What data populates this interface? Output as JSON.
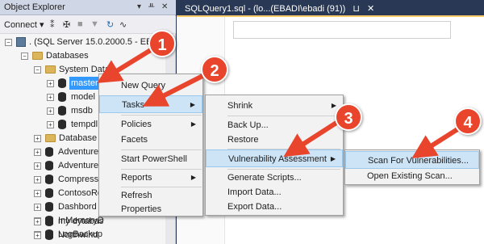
{
  "object_explorer": {
    "title": "Object Explorer",
    "pin_glyph": "▾ ⊔ ✕",
    "toolbar": {
      "connect_label": "Connect ▾"
    },
    "tree": {
      "server": ". (SQL Server 15.0.2000.5 - EBADI",
      "databases": "Databases",
      "system_databases": "System Datab",
      "system_dbs": [
        "master",
        "model",
        "msdb",
        "tempdl"
      ],
      "db_snapshots": "Database S",
      "user_dbs": [
        "AdventureW",
        "AdventureW",
        "Compressi",
        "ContosoRe",
        "Dashbord",
        "InMemoryD",
        "LogBackup",
        "my dytabas",
        "Northwind"
      ]
    }
  },
  "tab": {
    "label": "SQLQuery1.sql - (lo...(EBADI\\ebadi (91))",
    "pin": "⊔",
    "close": "✕"
  },
  "menu1": {
    "items": [
      "New Query",
      "Tasks",
      "Policies",
      "Facets",
      "Start PowerShell",
      "Reports",
      "Refresh",
      "Properties"
    ]
  },
  "menu2": {
    "items": [
      "Shrink",
      "Back Up...",
      "Restore",
      "Vulnerability Assessment",
      "Generate Scripts...",
      "Import Data...",
      "Export Data..."
    ]
  },
  "menu3": {
    "items": [
      "Scan For Vulnerabilities...",
      "Open Existing Scan..."
    ]
  },
  "badges": [
    "1",
    "2",
    "3",
    "4"
  ],
  "colors": {
    "arrow_red": "#e8452c",
    "selection": "#3399ff",
    "menu_highlight": "#cde4f7"
  }
}
